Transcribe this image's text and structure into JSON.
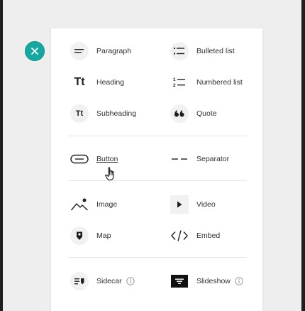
{
  "close_button": {
    "icon": "close-icon",
    "color": "#15a8a1"
  },
  "menu": {
    "text_items": [
      {
        "label": "Paragraph",
        "icon": "paragraph-icon"
      },
      {
        "label": "Bulleted list",
        "icon": "bulleted-list-icon"
      },
      {
        "label": "Heading",
        "icon": "heading-icon",
        "glyph": "Tt"
      },
      {
        "label": "Numbered list",
        "icon": "numbered-list-icon"
      },
      {
        "label": "Subheading",
        "icon": "subheading-icon",
        "glyph": "Tt"
      },
      {
        "label": "Quote",
        "icon": "quote-icon"
      }
    ],
    "layout_items": [
      {
        "label": "Button",
        "icon": "button-icon"
      },
      {
        "label": "Separator",
        "icon": "separator-icon"
      }
    ],
    "media_items": [
      {
        "label": "Image",
        "icon": "image-icon"
      },
      {
        "label": "Video",
        "icon": "video-icon"
      },
      {
        "label": "Map",
        "icon": "map-pin-icon"
      },
      {
        "label": "Embed",
        "icon": "embed-code-icon"
      }
    ],
    "advanced_items": [
      {
        "label": "Sidecar",
        "icon": "sidecar-icon",
        "info_icon": "info-icon"
      },
      {
        "label": "Slideshow",
        "icon": "slideshow-icon",
        "info_icon": "info-icon"
      }
    ]
  }
}
